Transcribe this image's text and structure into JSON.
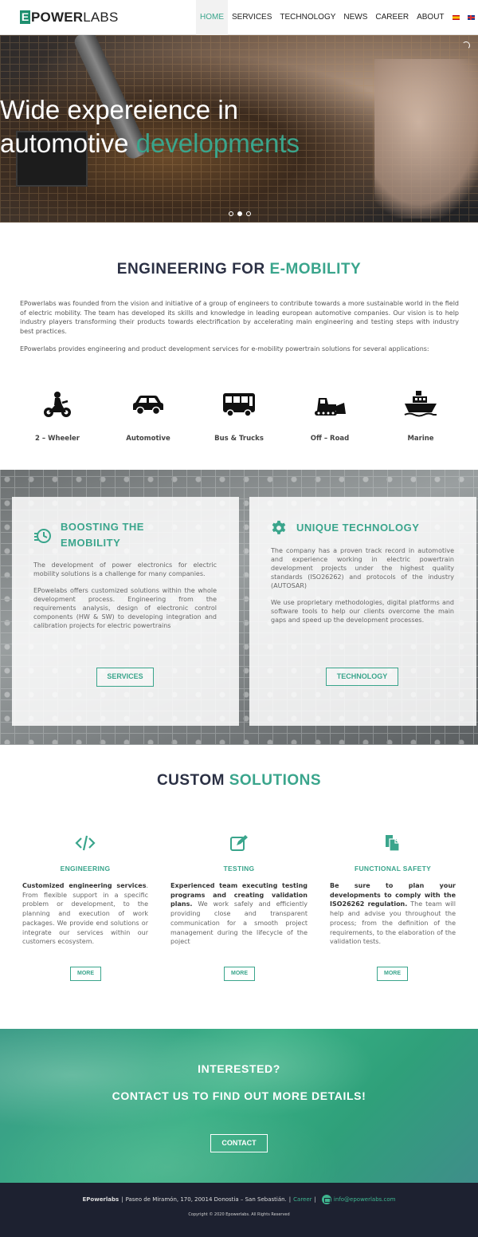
{
  "header": {
    "logo_letter": "E",
    "logo_rest_bold": "POWER",
    "logo_rest": "LABS",
    "nav": [
      "HOME",
      "SERVICES",
      "TECHNOLOGY",
      "NEWS",
      "CAREER",
      "ABOUT"
    ],
    "active_nav": "HOME"
  },
  "hero": {
    "title_line1": "Wide expereience in",
    "title_line2_plain": "automotive ",
    "title_line2_accent": "developments",
    "slide_count": 3,
    "active_slide": 2
  },
  "engineering": {
    "title_plain": "ENGINEERING FOR ",
    "title_accent": "E-MOBILITY",
    "paragraph1": "EPowerlabs was founded from the vision and initiative of a group of engineers to contribute towards a more sustainable world in the field of electric mobility. The team has developed its skills and knowledge in leading european automotive companies. Our vision is to help industry players transforming their products towards electrification by accelerating main engineering and testing steps with industry best practices.",
    "paragraph2": "EPowerlabs provides engineering and product development services for e-mobility powertrain solutions for several applications:",
    "applications": [
      {
        "label": "2 – Wheeler",
        "icon": "motorcycle-icon"
      },
      {
        "label": "Automotive",
        "icon": "car-icon"
      },
      {
        "label": "Bus & Trucks",
        "icon": "bus-icon"
      },
      {
        "label": "Off – Road",
        "icon": "bulldozer-icon"
      },
      {
        "label": "Marine",
        "icon": "ship-icon"
      }
    ]
  },
  "features": {
    "left": {
      "title_line1": "BOOSTING THE",
      "title_line2": "EMOBILITY",
      "icon": "history-clock-icon",
      "p1": "The development of power electronics for electric mobility solutions is a challenge for many companies.",
      "p2": "EPowelabs offers customized solutions within the whole development process. Engineering from the requirements analysis, design of electronic control components (HW & SW) to developing integration and calibration projects for electric powertrains",
      "button": "SERVICES"
    },
    "right": {
      "title": "UNIQUE TECHNOLOGY",
      "icon": "gear-icon",
      "p1": "The company  has a proven track record in automotive and experience working in electric powertrain development projects under the highest quality standards (ISO26262) and protocols of the industry (AUTOSAR)",
      "p2": "We use proprietary methodologies, digital platforms and software tools to help our clients overcome the main gaps and speed up the development processes.",
      "button": "TECHNOLOGY"
    }
  },
  "solutions": {
    "title_plain": "CUSTOM ",
    "title_accent": "SOLUTIONS",
    "items": [
      {
        "heading": "ENGINEERING",
        "icon": "code-icon",
        "bold": "Customized engineering services",
        "text": ". From flexible support in a specific problem or development, to the planning and execution of work packages. We provide end solutions or integrate our services within our customers ecosystem.",
        "button": "MORE"
      },
      {
        "heading": "TESTING",
        "icon": "edit-icon",
        "bold": "Experienced team executing testing programs and creating validation plans.",
        "text": " We work safely and efficiently providing close and transparent communication for a smooth project management during the lifecycle of the poject",
        "button": "MORE"
      },
      {
        "heading": "FUNCTIONAL SAFETY",
        "icon": "documents-icon",
        "bold": "Be sure to plan your developments to comply with the ISO26262 regulation.",
        "text": " The team will help and advise you throughout the process; from the definition of the requirements, to the elaboration of the validation tests.",
        "button": "MORE"
      }
    ]
  },
  "contact": {
    "line1": "INTERESTED?",
    "line2": "CONTACT US TO FIND OUT MORE DETAILS!",
    "button": "CONTACT"
  },
  "footer": {
    "company": "EPowerlabs",
    "address": "Paseo de Miramón, 170, 20014 Donostia – San Sebastián.",
    "career_link": "Career",
    "email": "info@epowerlabs.com",
    "copyright": "Copyright © 2020 Epowerlabs. All Rights Reserved"
  },
  "colors": {
    "accent": "#3aa58c",
    "navy": "#2b3044",
    "footer_bg": "#1d2130"
  }
}
